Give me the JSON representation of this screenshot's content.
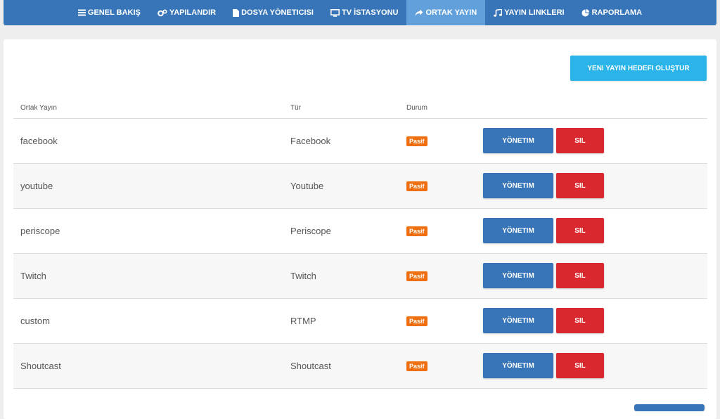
{
  "nav": {
    "items": [
      {
        "label": "GENEL BAKIŞ",
        "icon": "list-icon"
      },
      {
        "label": "YAPILANDIR",
        "icon": "gears-icon"
      },
      {
        "label": "DOSYA YÖNETICISI",
        "icon": "file-icon"
      },
      {
        "label": "TV İSTASYONU",
        "icon": "monitor-icon"
      },
      {
        "label": "ORTAK YAYIN",
        "icon": "share-icon"
      },
      {
        "label": "YAYIN LINKLERI",
        "icon": "music-icon"
      },
      {
        "label": "RAPORLAMA",
        "icon": "pie-chart-icon"
      }
    ],
    "active_index": 4
  },
  "actions": {
    "new_target_label": "YENI YAYIN HEDEFI OLUŞTUR"
  },
  "table": {
    "headers": {
      "name": "Ortak Yayın",
      "type": "Tür",
      "status": "Durum"
    },
    "manage_label": "YÖNETIM",
    "delete_label": "SIL",
    "rows": [
      {
        "name": "facebook",
        "type": "Facebook",
        "status": "Pasif"
      },
      {
        "name": "youtube",
        "type": "Youtube",
        "status": "Pasif"
      },
      {
        "name": "periscope",
        "type": "Periscope",
        "status": "Pasif"
      },
      {
        "name": "Twitch",
        "type": "Twitch",
        "status": "Pasif"
      },
      {
        "name": "custom",
        "type": "RTMP",
        "status": "Pasif"
      },
      {
        "name": "Shoutcast",
        "type": "Shoutcast",
        "status": "Pasif"
      }
    ]
  },
  "colors": {
    "nav_bg": "#3775b8",
    "nav_active": "#62a0dc",
    "primary": "#3775b8",
    "danger": "#d9292f",
    "info": "#2ab4ea",
    "badge_warning": "#ee6e10"
  }
}
